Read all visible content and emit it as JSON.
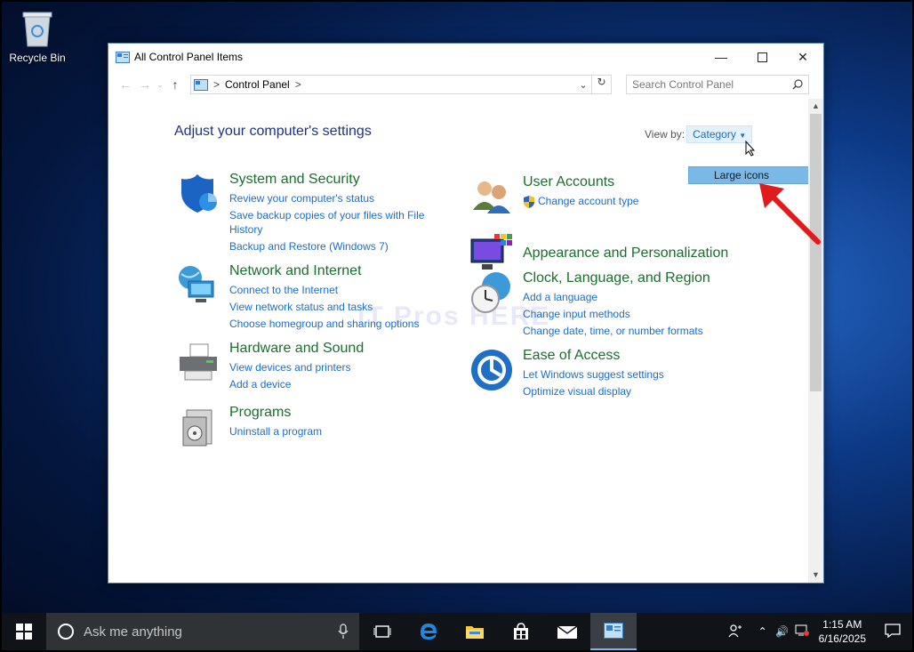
{
  "desktop": {
    "recycle_bin_label": "Recycle Bin"
  },
  "window": {
    "title": "All Control Panel Items",
    "address": {
      "crumb": "Control Panel",
      "sep1": ">",
      "sep2": ">"
    },
    "search_placeholder": "Search Control Panel"
  },
  "content": {
    "heading": "Adjust your computer's settings",
    "view_by_label": "View by:",
    "view_by_value": "Category",
    "dropdown_option": "Large icons",
    "watermark": "IT Pros HERE",
    "categories": [
      {
        "title": "System and Security",
        "links": [
          "Review your computer's status",
          "Save backup copies of your files with File",
          "History",
          "Backup and Restore (Windows 7)"
        ]
      },
      {
        "title": "Network and Internet",
        "links": [
          "Connect to the Internet",
          "View network status and tasks",
          "Choose homegroup and sharing options"
        ]
      },
      {
        "title": "Hardware and Sound",
        "links": [
          "View devices and printers",
          "Add a device"
        ]
      },
      {
        "title": "Programs",
        "links": [
          "Uninstall a program"
        ]
      },
      {
        "title": "User Accounts",
        "links": [
          "Change account type"
        ]
      },
      {
        "title": "Appearance and Personalization",
        "links": []
      },
      {
        "title": "Clock, Language, and Region",
        "links": [
          "Add a language",
          "Change input methods",
          "Change date, time, or number formats"
        ]
      },
      {
        "title": "Ease of Access",
        "links": [
          "Let Windows suggest settings",
          "Optimize visual display"
        ]
      }
    ]
  },
  "taskbar": {
    "search_placeholder": "Ask me anything",
    "time": "1:15 AM",
    "date": "6/16/2025"
  },
  "colors": {
    "link": "#1e6cc9",
    "category_title": "#1a6e2e",
    "heading": "#1e3287",
    "dropdown_highlight": "#7ab8e8"
  }
}
